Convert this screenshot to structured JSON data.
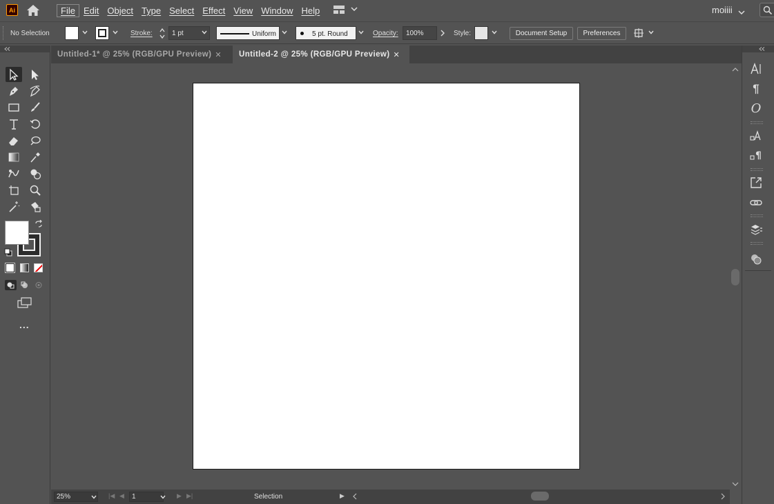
{
  "menubar": {
    "logo_text": "Ai",
    "items": [
      "File",
      "Edit",
      "Object",
      "Type",
      "Select",
      "Effect",
      "View",
      "Window",
      "Help"
    ],
    "user": "moiiii"
  },
  "controlbar": {
    "selection_label": "No Selection",
    "stroke_label": "Stroke:",
    "stroke_weight": "1 pt",
    "stroke_profile": "Uniform",
    "brush": "5 pt. Round",
    "opacity_label": "Opacity:",
    "opacity_value": "100%",
    "style_label": "Style:",
    "document_setup": "Document Setup",
    "preferences": "Preferences"
  },
  "tabs": [
    {
      "label": "Untitled-1* @ 25% (RGB/GPU Preview)",
      "active": false
    },
    {
      "label": "Untitled-2 @ 25% (RGB/GPU Preview)",
      "active": true
    }
  ],
  "statusbar": {
    "zoom": "25%",
    "page": "1",
    "tool": "Selection"
  },
  "toolbar": {
    "more_tools": "..."
  },
  "colors": {
    "ui_bg": "#535353",
    "tab_bg": "#424242",
    "artboard": "#ffffff",
    "logo_orange": "#ff9a00"
  }
}
